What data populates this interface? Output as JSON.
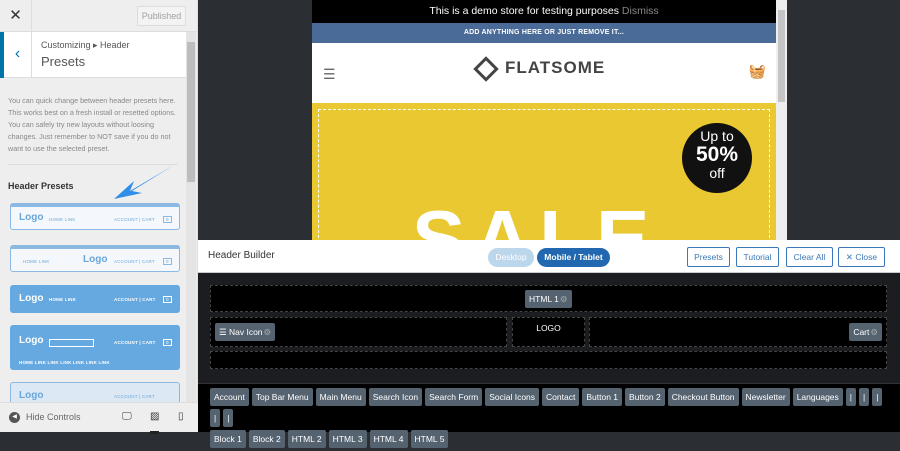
{
  "customizer": {
    "close_icon": "close-icon",
    "published_label": "Published",
    "breadcrumb": "Customizing ▸ Header",
    "title": "Presets",
    "description": "You can quick change between header presets here. This works best on a fresh install or resetted options. You can safely try new layouts without loosing changes. Just remember to NOT save if you do not want to use the selected preset.",
    "section_heading": "Header Presets",
    "presets": [
      {
        "logo": "Logo",
        "left": "HOME  LINK",
        "right": "ACCOUNT | CART",
        "cart": "0"
      },
      {
        "logo": "Logo",
        "left": "HOME  LINK",
        "right": "ACCOUNT | CART",
        "cart": "0"
      },
      {
        "logo": "Logo",
        "left": "HOME LINK",
        "right": "ACCOUNT | CART",
        "cart": "0"
      },
      {
        "logo": "Logo",
        "left": "",
        "right": "ACCOUNT | CART",
        "cart": "0",
        "nav": "HOME LINK   LINK LINK LINK LINK LINK"
      },
      {
        "logo": "Logo",
        "left": "",
        "right": "ACCOUNT | CART",
        "cart": "0"
      }
    ],
    "hide_controls": "Hide Controls",
    "accent": "#0073aa"
  },
  "preview": {
    "demo_notice": "This is a demo store for testing purposes",
    "dismiss": "Dismiss",
    "promo": "ADD ANYTHING HERE OR JUST REMOVE IT...",
    "brand": "FLATSOME",
    "badge": {
      "line1": "Up to",
      "line2": "50%",
      "line3": "off"
    },
    "hero_text": "SALE"
  },
  "header_builder": {
    "title": "Header Builder",
    "modes": [
      "Desktop",
      "Mobile / Tablet"
    ],
    "active_mode": "Mobile / Tablet",
    "buttons": {
      "presets": "Presets",
      "tutorial": "Tutorial",
      "clear_all": "Clear All",
      "close": "✕ Close"
    },
    "top_row": [
      "HTML 1"
    ],
    "main_left": "☰ Nav Icon",
    "main_center": "LOGO",
    "main_right": "Cart",
    "palette": [
      "Account",
      "Top Bar Menu",
      "Main Menu",
      "Search Icon",
      "Search Form",
      "Social Icons",
      "Contact",
      "Button 1",
      "Button 2",
      "Checkout Button",
      "Newsletter",
      "Languages",
      "|",
      "|",
      "|",
      "|",
      "|",
      "Block 1",
      "Block 2",
      "HTML 2",
      "HTML 3",
      "HTML 4",
      "HTML 5"
    ]
  }
}
